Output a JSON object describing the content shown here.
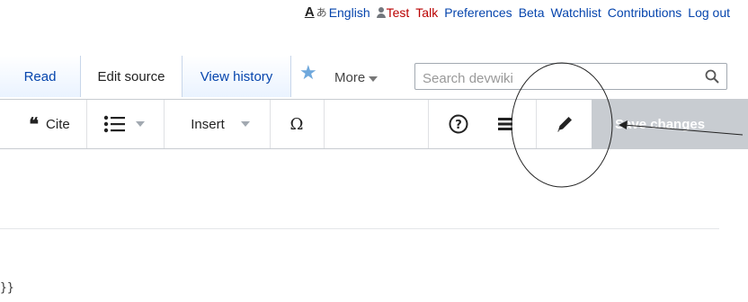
{
  "personal_tools": {
    "uls_big": "A",
    "uls_small": "あ",
    "language": "English",
    "user": "Test",
    "talk": "Talk",
    "preferences": "Preferences",
    "beta": "Beta",
    "watchlist": "Watchlist",
    "contributions": "Contributions",
    "logout": "Log out"
  },
  "tabs": {
    "read": "Read",
    "edit_source": "Edit source",
    "view_history": "View history",
    "more": "More",
    "watch_icon": "star-icon"
  },
  "search": {
    "placeholder": "Search devwiki",
    "icon": "search-icon"
  },
  "toolbar": {
    "cite_label": "Cite",
    "insert_label": "Insert",
    "special_char": "Ω",
    "help_icon": "help-icon",
    "menu_icon": "hamburger-icon",
    "edit_mode_icon": "pencil-icon",
    "save_label": "Save changes"
  },
  "content": {
    "code_fragment": "}}"
  },
  "colors": {
    "link": "#0645ad",
    "red_link": "#ba0000",
    "save_disabled": "#c8ccd1"
  }
}
